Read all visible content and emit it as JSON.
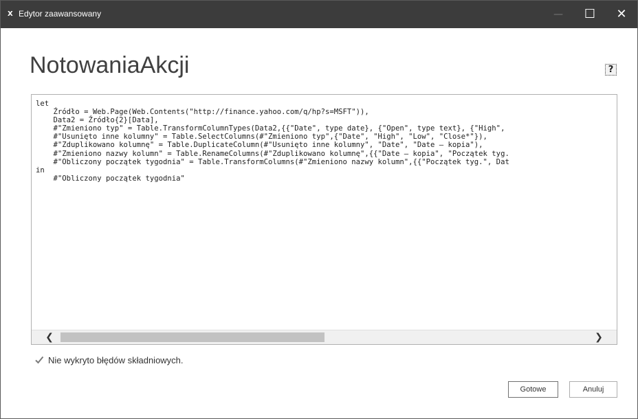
{
  "window": {
    "title": "Edytor zaawansowany",
    "app_icon_label": "X",
    "controls": {
      "minimize": "—",
      "maximize": "☐",
      "close": "✕"
    }
  },
  "page_title": "NotowaniaAkcji",
  "help": {
    "label": "?"
  },
  "editor": {
    "lines": [
      "let",
      "    Źródło = Web.Page(Web.Contents(\"http://finance.yahoo.com/q/hp?s=MSFT\")),",
      "    Data2 = Źródło{2}[Data],",
      "    #\"Zmieniono typ\" = Table.TransformColumnTypes(Data2,{{\"Date\", type date}, {\"Open\", type text}, {\"High\",",
      "    #\"Usunięto inne kolumny\" = Table.SelectColumns(#\"Zmieniono typ\",{\"Date\", \"High\", \"Low\", \"Close*\"}),",
      "    #\"Zduplikowano kolumnę\" = Table.DuplicateColumn(#\"Usunięto inne kolumny\", \"Date\", \"Date – kopia\"),",
      "    #\"Zmieniono nazwy kolumn\" = Table.RenameColumns(#\"Zduplikowano kolumnę\",{{\"Date – kopia\", \"Początek tyg.",
      "    #\"Obliczony początek tygodnia\" = Table.TransformColumns(#\"Zmieniono nazwy kolumn\",{{\"Początek tyg.\", Dat",
      "in",
      "    #\"Obliczony początek tygodnia\""
    ],
    "scroll_left": "❮",
    "scroll_right": "❯"
  },
  "status": {
    "icon": "check-icon",
    "text": "Nie wykryto błędów składniowych."
  },
  "buttons": {
    "ok": "Gotowe",
    "cancel": "Anuluj"
  },
  "colors": {
    "titlebar": "#3c3c3c",
    "scroll_thumb": "#c2c2c2",
    "check": "#7a7a7a"
  }
}
